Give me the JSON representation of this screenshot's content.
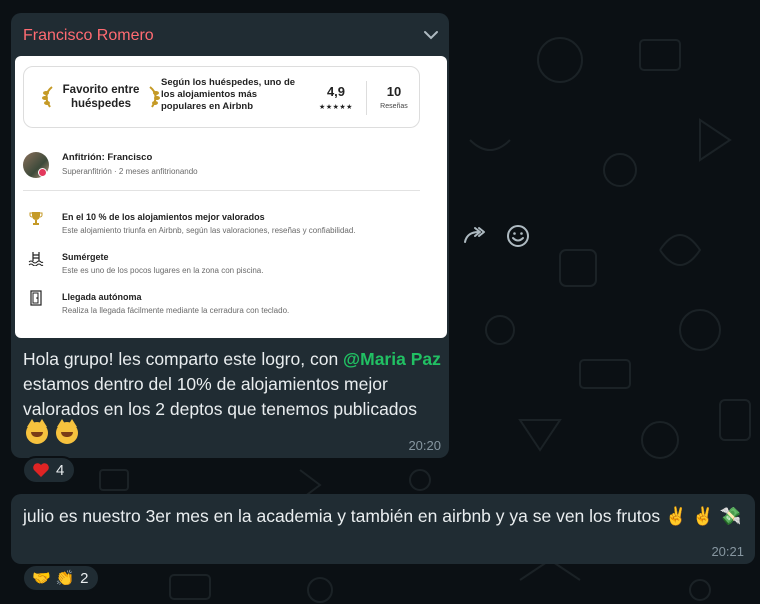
{
  "chat": {
    "messages": [
      {
        "sender": "Francisco Romero",
        "card": {
          "favorite_title": "Favorito entre huéspedes",
          "favorite_desc": "Según los huéspedes, uno de los alojamientos más populares en Airbnb",
          "rating": "4,9",
          "stars": "★★★★★",
          "reviews_count": "10",
          "reviews_label": "Reseñas",
          "host_name": "Anfitrión: Francisco",
          "host_sub": "Superanfitrión · 2 meses anfitrionando",
          "features": [
            {
              "icon": "trophy-icon",
              "title": "En el 10 % de los alojamientos mejor valorados",
              "desc": "Este alojamiento triunfa en Airbnb, según las valoraciones, reseñas y confiabilidad."
            },
            {
              "icon": "pool-icon",
              "title": "Sumérgete",
              "desc": "Este es uno de los pocos lugares en la zona con piscina."
            },
            {
              "icon": "door-icon",
              "title": "Llegada autónoma",
              "desc": "Realiza la llegada fácilmente mediante la cerradura con teclado."
            }
          ]
        },
        "text_before": "Hola grupo! les comparto este logro, con ",
        "mention": "@Maria Paz",
        "text_after": " estamos dentro del 10% de alojamientos mejor valorados en los 2 deptos que tenemos publicados",
        "time": "20:20",
        "reaction": {
          "emoji": "heart",
          "count": "4"
        }
      },
      {
        "text": "julio es nuestro 3er mes en la academia y también en airbnb y ya se ven los frutos",
        "emoji_trail": "✌️ ✌️ 💸",
        "time": "20:21",
        "reaction": {
          "emojis": "🤝 👏",
          "count": "2"
        }
      }
    ]
  },
  "colors": {
    "background": "#0b1014",
    "bubble": "#202c33",
    "sender_name": "#ff6b72",
    "mention": "#21c063",
    "timestamp": "#8696a0"
  },
  "icons": [
    "chevron-down-icon",
    "laurel-left-icon",
    "laurel-right-icon",
    "trophy-icon",
    "pool-icon",
    "door-icon",
    "forward-icon",
    "emoji-icon",
    "heart-icon"
  ]
}
